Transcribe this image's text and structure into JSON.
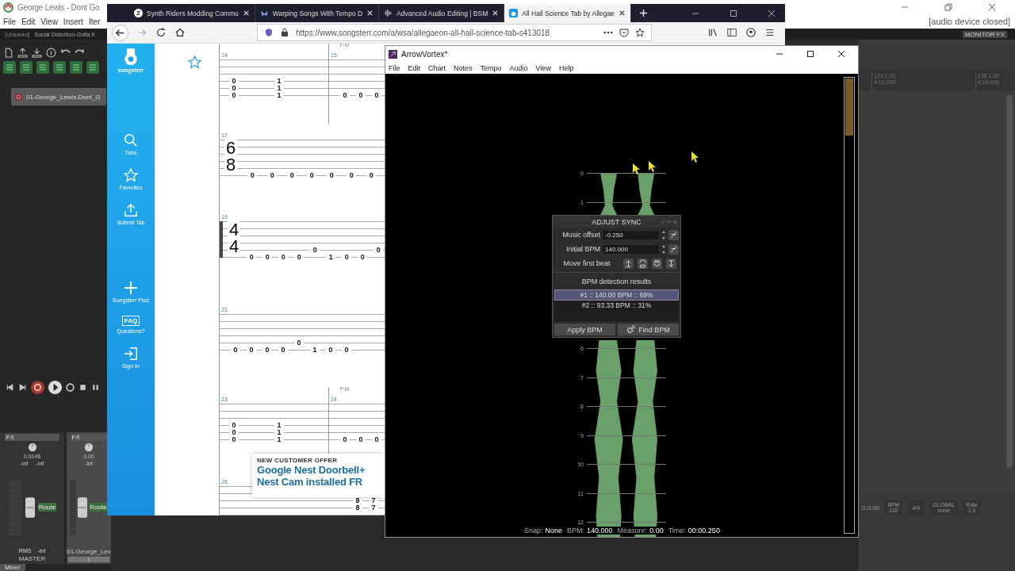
{
  "reaper": {
    "title": "George Lewis - Dont Go",
    "menu": [
      "File",
      "Edit",
      "View",
      "Insert",
      "Iter"
    ],
    "project_tabs": [
      {
        "label": "[Unsaved]",
        "selected": false
      },
      {
        "label": "Social Distortion-Gotta K",
        "selected": true
      }
    ],
    "status": "[audio device closed]",
    "monitor_fx": "MONITOR FX",
    "track": {
      "name": "01-George_Lewis-Dont_G"
    },
    "ruler": [
      {
        "measure": "129.1.00",
        "time": "4:16.000"
      },
      {
        "measure": "130.1.00",
        "time": "4:18.000"
      }
    ],
    "info": {
      "time": "0.0.00",
      "bpm_label": "BPM",
      "bpm": "120",
      "signature": "4/4",
      "global_label": "GLOBAL",
      "global_value": "none",
      "rate_label": "Rate",
      "rate": "1.0"
    },
    "mixer": [
      {
        "name": "MASTER",
        "fx": "FX",
        "readout": "0.0048",
        "peaks": [
          "-inf",
          "-inf"
        ],
        "rms_label": "RMS",
        "rms": "-inf",
        "route": "Route",
        "selected": false
      },
      {
        "name": "01-George_Lev",
        "number": "1",
        "fx": "FX",
        "readout": "0.00",
        "peaks": [
          "-inf"
        ],
        "route": "Route",
        "selected": true
      }
    ],
    "dock_tab": "Mixer"
  },
  "browser": {
    "tabs": [
      {
        "label": "Synth Riders Modding Commu",
        "kind": "zed",
        "selected": false
      },
      {
        "label": "Warping Songs With Tempo D",
        "kind": "wings",
        "selected": false
      },
      {
        "label": "Advanced Audio Editing | BSM",
        "kind": "wave",
        "selected": false
      },
      {
        "label": "All Hail Science Tab by Allegae",
        "kind": "guitar",
        "selected": true
      }
    ],
    "url": "https://www.songsterr.com/a/wsa/allegaeon-all-hail-science-tab-s413018",
    "sidebar": {
      "logo": "songsterr",
      "items": [
        {
          "label": "Tabs",
          "kind": "search"
        },
        {
          "label": "Favorites",
          "kind": "star"
        },
        {
          "label": "Submit Tab",
          "kind": "upload"
        },
        {
          "label": "Songsterr Plus",
          "kind": "plus"
        },
        {
          "label": "Questions?",
          "kind": "faq",
          "icon_text": "FAQ"
        },
        {
          "label": "Sign In",
          "kind": "signin"
        }
      ]
    },
    "systems": [
      {
        "measures": [
          {
            "number": "14",
            "columns": [
              {
                "kind": "triad",
                "frets": [
                  "0",
                  "0",
                  "0"
                ]
              },
              {
                "kind": "triad",
                "frets": [
                  "1",
                  "1",
                  "1"
                ]
              }
            ]
          },
          {
            "number": "15",
            "annotation": "P.M.",
            "columns": [
              {
                "kind": "low",
                "frets": [
                  "0"
                ]
              },
              {
                "kind": "low",
                "frets": [
                  "0"
                ]
              },
              {
                "kind": "low",
                "frets": [
                  "0"
                ]
              }
            ]
          }
        ]
      },
      {
        "measures": [
          {
            "number": "17",
            "time_signature": [
              "6",
              "8"
            ],
            "columns": [
              {
                "kind": "low",
                "frets": [
                  "0"
                ]
              },
              {
                "kind": "low",
                "frets": [
                  "0"
                ]
              },
              {
                "kind": "low",
                "frets": [
                  "0"
                ]
              },
              {
                "kind": "low",
                "frets": [
                  "0"
                ]
              },
              {
                "kind": "low",
                "frets": [
                  "0"
                ]
              },
              {
                "kind": "low",
                "frets": [
                  "0"
                ]
              },
              {
                "kind": "low",
                "frets": [
                  "0"
                ]
              }
            ]
          }
        ]
      },
      {
        "measures": [
          {
            "number": "19",
            "repeat_start": true,
            "time_signature": [
              "4",
              "4"
            ],
            "columns": [
              {
                "kind": "low",
                "frets": [
                  "0"
                ]
              },
              {
                "kind": "low",
                "frets": [
                  "0"
                ]
              },
              {
                "kind": "low",
                "frets": [
                  "0"
                ]
              },
              {
                "kind": "low",
                "frets": [
                  "0"
                ]
              },
              {
                "kind": "mid",
                "frets": [
                  "0"
                ]
              },
              {
                "kind": "low",
                "frets": [
                  "1"
                ]
              },
              {
                "kind": "low",
                "frets": [
                  "0"
                ]
              },
              {
                "kind": "low",
                "frets": [
                  "0"
                ]
              },
              {
                "kind": "mid",
                "frets": [
                  "0"
                ]
              }
            ]
          }
        ]
      },
      {
        "measures": [
          {
            "number": "21",
            "columns": [
              {
                "kind": "low",
                "frets": [
                  "0"
                ]
              },
              {
                "kind": "low",
                "frets": [
                  "0"
                ]
              },
              {
                "kind": "low",
                "frets": [
                  "0"
                ]
              },
              {
                "kind": "low",
                "frets": [
                  "0"
                ]
              },
              {
                "kind": "mid",
                "frets": [
                  "0"
                ]
              },
              {
                "kind": "low",
                "frets": [
                  "1"
                ]
              },
              {
                "kind": "low",
                "frets": [
                  "0"
                ]
              },
              {
                "kind": "low",
                "frets": [
                  "0"
                ]
              }
            ]
          }
        ]
      },
      {
        "measures": [
          {
            "number": "23",
            "columns": [
              {
                "kind": "triad",
                "frets": [
                  "0",
                  "0",
                  "0"
                ]
              },
              {
                "kind": "triad",
                "frets": [
                  "1",
                  "1",
                  "1"
                ]
              }
            ]
          },
          {
            "number": "24",
            "annotation": "P.M.",
            "columns": [
              {
                "kind": "low",
                "frets": [
                  "0"
                ]
              },
              {
                "kind": "low",
                "frets": [
                  "0"
                ]
              },
              {
                "kind": "low",
                "frets": [
                  "0"
                ]
              }
            ]
          }
        ]
      },
      {
        "measures": [
          {
            "number": "26",
            "columns": [
              {
                "kind": "dyad",
                "frets": [
                  "8",
                  "8"
                ]
              },
              {
                "kind": "dyad",
                "frets": [
                  "7",
                  "7"
                ]
              }
            ]
          }
        ]
      }
    ],
    "ad": {
      "kicker": "NEW CUSTOMER OFFER",
      "headline": [
        "Google Nest Doorbell+",
        "Nest Cam installed FR"
      ]
    }
  },
  "vortex": {
    "title": "ArrowVortex*",
    "menu": [
      "File",
      "Edit",
      "Chart",
      "Notes",
      "Tempo",
      "Audio",
      "View",
      "Help"
    ],
    "beats_above": [
      "0",
      "1"
    ],
    "beats_below": [
      "6",
      "7",
      "8",
      "9",
      "10",
      "11",
      "12"
    ],
    "dialog": {
      "title": "ADJUST SYNC",
      "fields": [
        {
          "label": "Music offset",
          "value": "-0.250"
        },
        {
          "label": "Initial BPM",
          "value": "140.000"
        }
      ],
      "move_label": "Move first beat",
      "move_buttons": [
        {
          "kind": "up"
        },
        {
          "kind": "half-left"
        },
        {
          "kind": "half-right"
        },
        {
          "kind": "down"
        }
      ],
      "results_title": "BPM detection results",
      "results": [
        {
          "label": "#1 :: 140.00 BPM :: 69%",
          "selected": true
        },
        {
          "label": "#2 :: 93.33 BPM :: 31%",
          "selected": false
        }
      ],
      "buttons": [
        {
          "label": "Apply BPM",
          "kind": "plain"
        },
        {
          "label": "Find BPM",
          "kind": "gear"
        }
      ]
    },
    "status": [
      {
        "label": "Snap:",
        "value": "None"
      },
      {
        "label": "BPM:",
        "value": "140.000"
      },
      {
        "label": "Measure:",
        "value": "0.00"
      },
      {
        "label": "Time:",
        "value": "00:00.250"
      }
    ]
  }
}
